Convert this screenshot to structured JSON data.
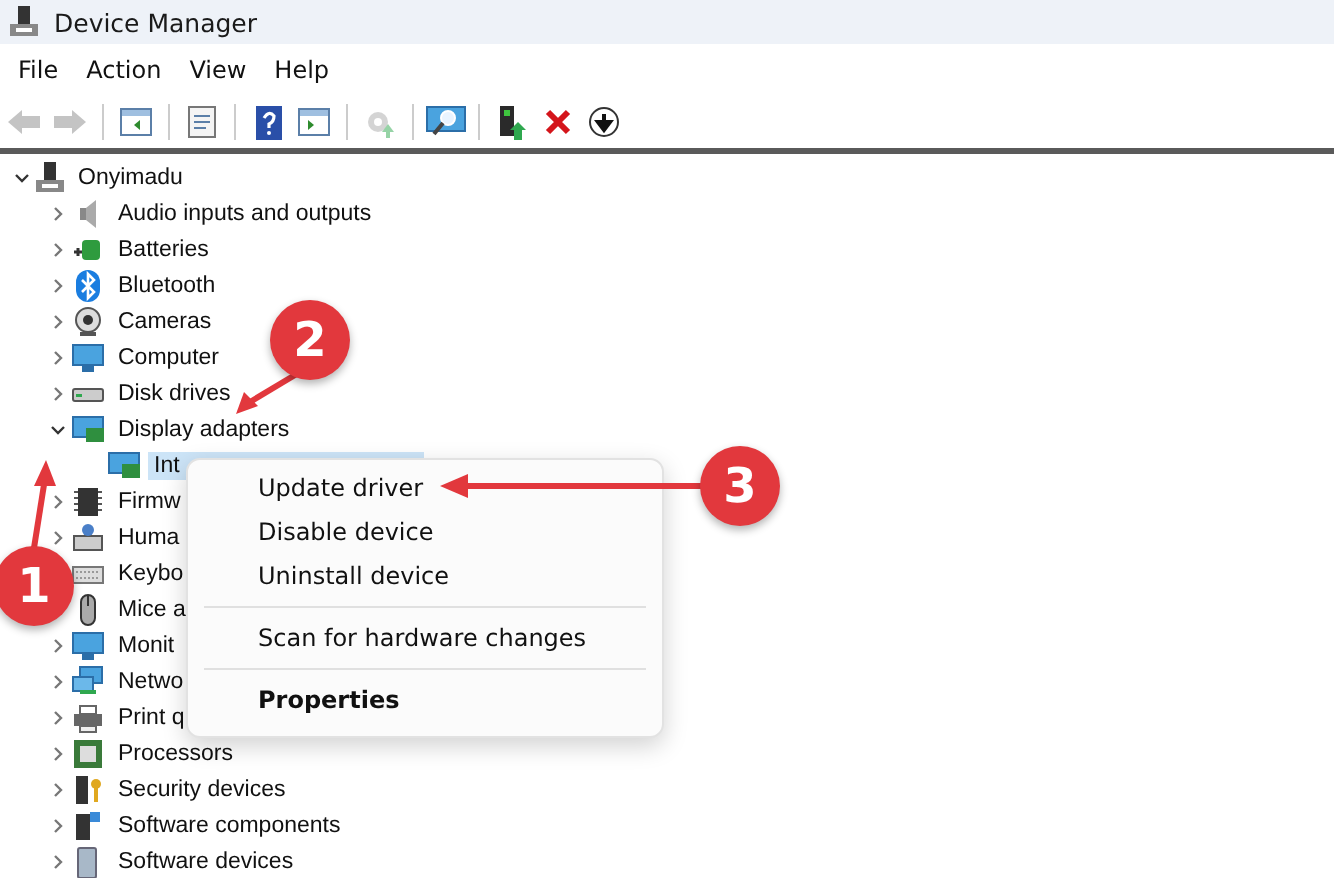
{
  "window": {
    "title": "Device Manager"
  },
  "menu_bar": [
    "File",
    "Action",
    "View",
    "Help"
  ],
  "toolbar": [
    {
      "disabled": true
    },
    {
      "disabled": true
    },
    {
      "disabled": false
    },
    {
      "disabled": false
    },
    {
      "disabled": false
    },
    {
      "disabled": false
    },
    {
      "disabled": true
    },
    {
      "disabled": false
    },
    {
      "disabled": false
    },
    {
      "disabled": false
    },
    {
      "disabled": false
    }
  ],
  "tree": {
    "label": "Onyimadu",
    "expanded": true,
    "children": [
      {
        "label": "Audio inputs and outputs",
        "expanded": false
      },
      {
        "label": "Batteries",
        "expanded": false
      },
      {
        "label": "Bluetooth",
        "expanded": false
      },
      {
        "label": "Cameras",
        "expanded": false
      },
      {
        "label": "Computer",
        "expanded": false
      },
      {
        "label": "Disk drives",
        "expanded": false
      },
      {
        "label": "Display adapters",
        "expanded": true,
        "children": [
          {
            "label": "Int",
            "selected": true
          }
        ]
      },
      {
        "label": "Firmw",
        "expanded": false
      },
      {
        "label": "Huma",
        "expanded": false
      },
      {
        "label": "Keybo"
      },
      {
        "label": "Mice a"
      },
      {
        "label": "Monit",
        "expanded": false
      },
      {
        "label": "Netwo",
        "expanded": false
      },
      {
        "label": "Print q",
        "expanded": false
      },
      {
        "label": "Processors",
        "expanded": false
      },
      {
        "label": "Security devices",
        "expanded": false
      },
      {
        "label": "Software components",
        "expanded": false
      },
      {
        "label": "Software devices",
        "expanded": false
      }
    ]
  },
  "context_menu": [
    {
      "kind": "item",
      "label": "Update driver",
      "default": false
    },
    {
      "kind": "item",
      "label": "Disable device",
      "default": false
    },
    {
      "kind": "item",
      "label": "Uninstall device",
      "default": false
    },
    {
      "kind": "separator"
    },
    {
      "kind": "item",
      "label": "Scan for hardware changes",
      "default": false
    },
    {
      "kind": "separator"
    },
    {
      "kind": "item",
      "label": "Properties",
      "default": true
    }
  ],
  "annotations": [
    {
      "number": "1"
    },
    {
      "number": "2"
    },
    {
      "number": "3"
    }
  ]
}
